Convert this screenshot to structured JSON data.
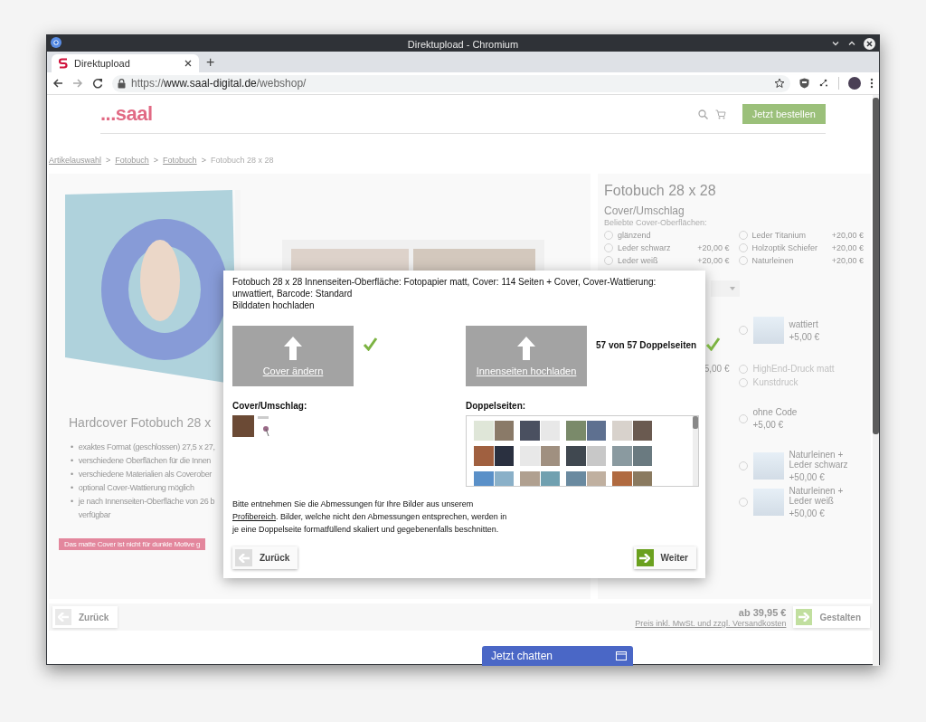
{
  "browser": {
    "window_title": "Direktupload - Chromium",
    "tabs": [
      {
        "title": "Direktupload",
        "selected": true
      }
    ],
    "new_tab": "+",
    "url": {
      "scheme": "https://",
      "host": "www.saal-digital.de",
      "path": "/webshop/"
    }
  },
  "header": {
    "logo": "...saal",
    "order_button": "Jetzt bestellen"
  },
  "breadcrumb": {
    "separator": ">",
    "items": [
      {
        "label": "Artikelauswahl",
        "current": false
      },
      {
        "label": "Fotobuch",
        "current": false
      },
      {
        "label": "Fotobuch",
        "current": false
      },
      {
        "label": "Fotobuch 28 x 28",
        "current": true
      }
    ]
  },
  "product": {
    "title": "Hardcover Fotobuch 28 x",
    "bullet": "•",
    "features": [
      "exaktes Format (geschlossen) 27,5 x 27,",
      "verschiedene Oberflächen für die Innen",
      "verschiedene Materialien als Coverober",
      "optional Cover-Wattierung möglich",
      "je nach Innenseiten-Oberfläche von 26 b\nverfügbar"
    ],
    "notice": "Das matte Cover ist nicht für dunkle Motive g"
  },
  "config": {
    "title": "Fotobuch 28 x 28",
    "section": "Cover/Umschlag",
    "hint": "Beliebte Cover-Oberflächen:",
    "options": [
      {
        "label": "glänzend",
        "selected": false
      },
      {
        "label": "Leder Titanium",
        "price": "+20,00 €",
        "selected": false
      },
      {
        "label": "Leder schwarz",
        "price": "+20,00 €",
        "selected": false
      },
      {
        "label": "Holzoptik Schiefer",
        "price": "+20,00 €",
        "selected": false
      },
      {
        "label": "Leder weiß",
        "price": "+20,00 €",
        "selected": false
      },
      {
        "label": "Naturleinen",
        "price": "+20,00 €",
        "selected": false
      }
    ],
    "groups": [
      {
        "kind": "select"
      },
      {
        "kind": "options",
        "right": [
          {
            "kind": "image",
            "label": "wattiert",
            "price": "+5,00 €",
            "selected": false,
            "disabled": false
          }
        ]
      },
      {
        "kind": "options",
        "left_price": "5,00 €",
        "right": [
          {
            "kind": "plain",
            "label": "HighEnd-Druck matt",
            "selected": false,
            "disabled": true
          },
          {
            "kind": "plain",
            "label": "Kunstdruck",
            "selected": false,
            "disabled": true
          }
        ]
      },
      {
        "kind": "options",
        "right": [
          {
            "kind": "plain",
            "label": "ohne Code",
            "price": "+5,00 €",
            "selected": false,
            "disabled": false
          }
        ]
      },
      {
        "kind": "options",
        "right": [
          {
            "kind": "image",
            "label": "Naturleinen + Leder schwarz",
            "price": "+50,00 €",
            "selected": false,
            "disabled": false
          },
          {
            "kind": "image",
            "label": "Naturleinen + Leder weiß",
            "price": "+50,00 €",
            "selected": false,
            "disabled": false
          }
        ]
      }
    ]
  },
  "footer": {
    "back": "Zurück",
    "price": "ab 39,95 €",
    "price_note": "Preis inkl. MwSt. und zzgl. Versandkosten",
    "next": "Gestalten"
  },
  "dialog": {
    "summary": "Fotobuch 28 x 28 Innenseiten-Oberfläche: Fotopapier matt, Cover: 114 Seiten + Cover, Cover-Wattierung: unwattiert, Barcode: Standard",
    "subtitle": "Bilddaten hochladen",
    "uploads": [
      {
        "label": "Cover ändern",
        "done": true
      },
      {
        "label": "Innenseiten hochladen",
        "status": "57 von 57 Doppelseiten",
        "done": true
      }
    ],
    "cover_heading": "Cover/Umschlag:",
    "spreads_heading": "Doppelseiten:",
    "note_before": "Bitte entnehmen Sie die Abmessungen für Ihre Bilder aus unserem ",
    "note_link": "Profibereich",
    "note_after": ". Bilder, welche nicht den Abmessungen entsprechen, werden in je eine Doppelseite formatfüllend skaliert und gegebenenfalls beschnitten.",
    "back": "Zurück",
    "next": "Weiter"
  },
  "chat": {
    "label": "Jetzt chatten"
  }
}
